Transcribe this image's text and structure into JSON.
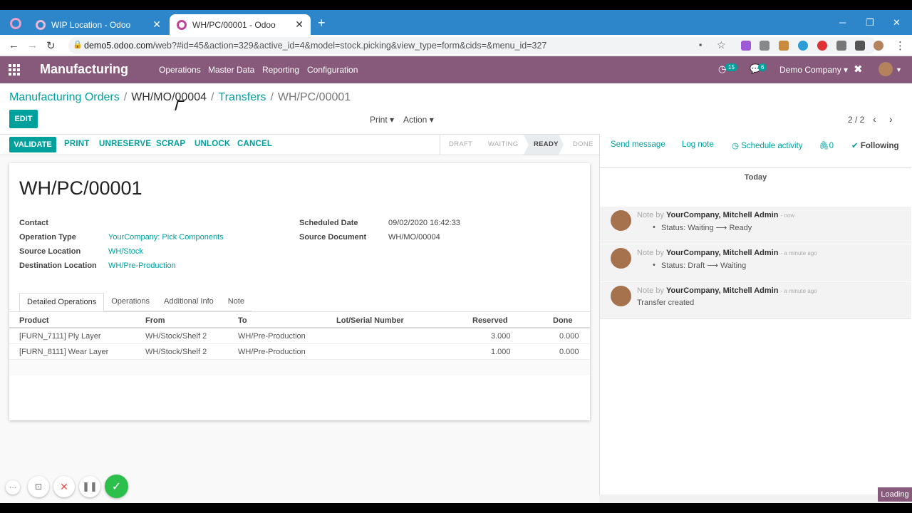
{
  "browser": {
    "tabs": [
      {
        "title": "WIP Location - Odoo",
        "close": "✕"
      },
      {
        "title": "WH/PC/00001 - Odoo",
        "close": "✕"
      }
    ],
    "new_tab": "+",
    "url_host": "demo5.odoo.com",
    "url_path": "/web?#id=45&action=329&active_id=4&model=stock.picking&view_type=form&cids=&menu_id=327"
  },
  "navbar": {
    "app_name": "Manufacturing",
    "menus": [
      "Operations",
      "Master Data",
      "Reporting",
      "Configuration"
    ],
    "activity_count": "15",
    "message_count": "6",
    "company": "Demo Company"
  },
  "breadcrumb": {
    "items": [
      "Manufacturing Orders",
      "WH/MO/00004",
      "Transfers"
    ],
    "current": "WH/PC/00001",
    "sep": "/"
  },
  "controls": {
    "edit": "EDIT",
    "print": "Print",
    "action": "Action",
    "pager": "2 / 2"
  },
  "statusbar": {
    "buttons": [
      "VALIDATE",
      "PRINT",
      "UNRESERVE",
      "SCRAP",
      "UNLOCK",
      "CANCEL"
    ],
    "stages": [
      "DRAFT",
      "WAITING",
      "READY",
      "DONE"
    ],
    "active_stage": "READY"
  },
  "record": {
    "name": "WH/PC/00001",
    "fields_left": [
      {
        "label": "Contact",
        "value": ""
      },
      {
        "label": "Operation Type",
        "value": "YourCompany: Pick Components"
      },
      {
        "label": "Source Location",
        "value": "WH/Stock"
      },
      {
        "label": "Destination Location",
        "value": "WH/Pre-Production"
      }
    ],
    "fields_right": [
      {
        "label": "Scheduled Date",
        "value": "09/02/2020 16:42:33"
      },
      {
        "label": "Source Document",
        "value": "WH/MO/00004"
      }
    ],
    "tabs": [
      "Detailed Operations",
      "Operations",
      "Additional Info",
      "Note"
    ],
    "columns": [
      "Product",
      "From",
      "To",
      "Lot/Serial Number",
      "Reserved",
      "Done"
    ],
    "rows": [
      [
        "[FURN_7111] Ply Layer",
        "WH/Stock/Shelf 2",
        "WH/Pre-Production",
        "",
        "3.000",
        "0.000"
      ],
      [
        "[FURN_8111] Wear Layer",
        "WH/Stock/Shelf 2",
        "WH/Pre-Production",
        "",
        "1.000",
        "0.000"
      ]
    ]
  },
  "chatter": {
    "send_message": "Send message",
    "log_note": "Log note",
    "schedule_activity": "Schedule activity",
    "attachments": "0",
    "following": "Following",
    "today": "Today",
    "messages": [
      {
        "prefix": "Note by",
        "author": "YourCompany, Mitchell Admin",
        "time": "- now",
        "body": "Status: Waiting ⟶ Ready",
        "bullet": true
      },
      {
        "prefix": "Note by",
        "author": "YourCompany, Mitchell Admin",
        "time": "- a minute ago",
        "body": "Status: Draft ⟶ Waiting",
        "bullet": true
      },
      {
        "prefix": "Note by",
        "author": "YourCompany, Mitchell Admin",
        "time": "- a minute ago",
        "body": "Transfer created",
        "bullet": false
      }
    ]
  },
  "loading": "Loading",
  "colors": {
    "brand": "#875a7b",
    "accent": "#00a09d",
    "chrome": "#2d86c9"
  }
}
